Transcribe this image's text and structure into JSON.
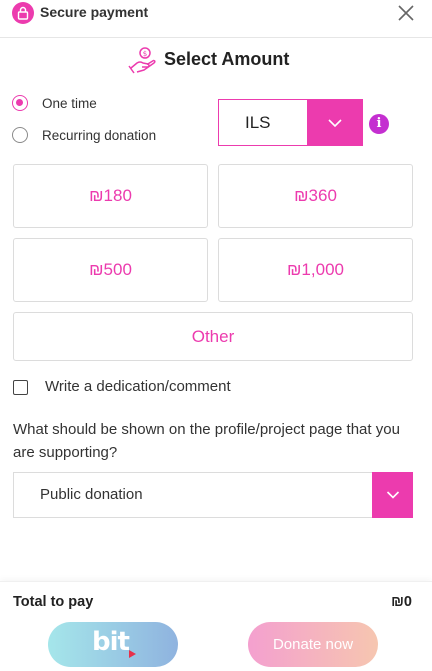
{
  "header": {
    "title": "Secure payment"
  },
  "title": "Select Amount",
  "frequency": {
    "options": [
      "One time",
      "Recurring donation"
    ],
    "selected_index": 0
  },
  "currency": {
    "value": "ILS"
  },
  "amounts": [
    "₪180",
    "₪360",
    "₪500",
    "₪1,000"
  ],
  "other_label": "Other",
  "dedication": {
    "label": "Write a dedication/comment",
    "checked": false
  },
  "display_question": "What should be shown on the profile/project page that you are supporting?",
  "display_select": {
    "value": "Public donation"
  },
  "footer": {
    "total_label": "Total to pay",
    "total_value": "₪0",
    "bit_label": "bit",
    "donate_label": "Donate now"
  },
  "colors": {
    "accent": "#ec3bae",
    "info": "#c42fd0"
  },
  "icons": [
    "lock-icon",
    "close-icon",
    "hand-coin-icon",
    "chevron-down-icon",
    "info-icon"
  ]
}
